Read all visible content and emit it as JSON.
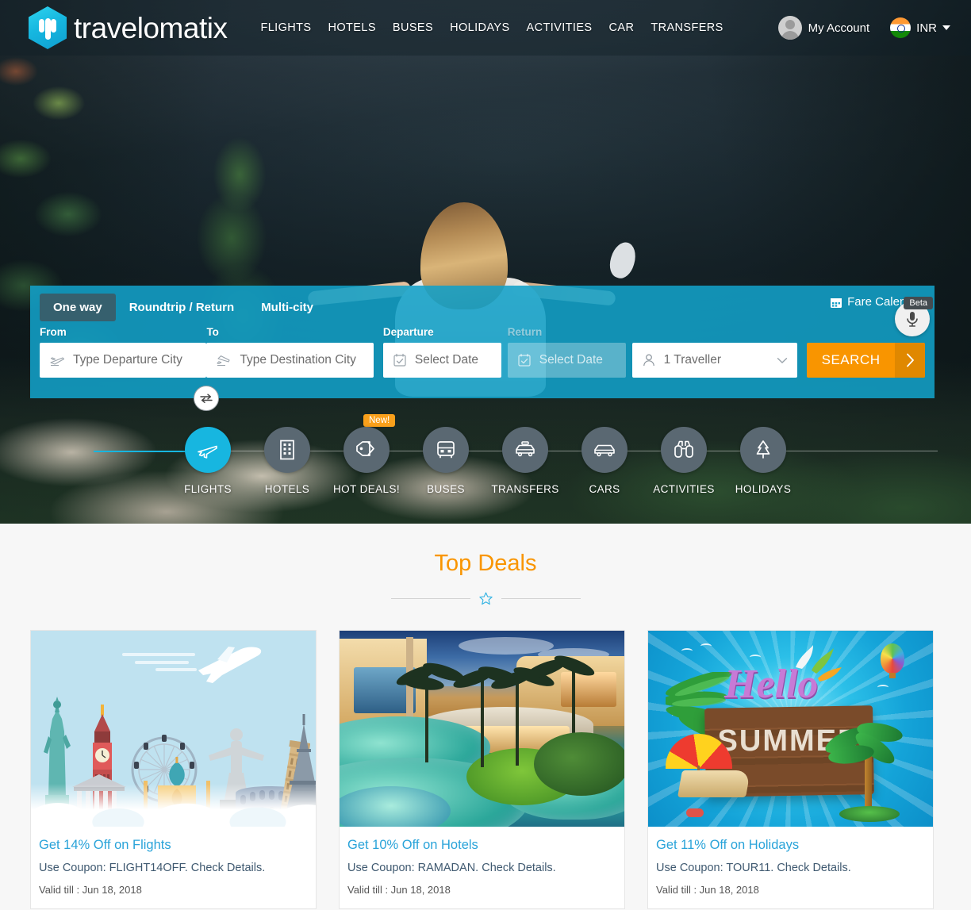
{
  "brand": {
    "name": "travelomatix",
    "logo_icon": "travelomatix-hex-logo"
  },
  "header": {
    "nav": [
      {
        "label": "FLIGHTS"
      },
      {
        "label": "HOTELS"
      },
      {
        "label": "BUSES"
      },
      {
        "label": "HOLIDAYS"
      },
      {
        "label": "ACTIVITIES"
      },
      {
        "label": "CAR"
      },
      {
        "label": "TRANSFERS"
      }
    ],
    "account": {
      "label": "My Account",
      "icon": "user-avatar-icon"
    },
    "currency": {
      "code": "INR",
      "flag": "india-flag-icon",
      "caret": "chevron-down-icon"
    }
  },
  "search_widget": {
    "trip_tabs": [
      {
        "label": "One way",
        "active": true
      },
      {
        "label": "Roundtrip / Return",
        "active": false
      },
      {
        "label": "Multi-city",
        "active": false
      }
    ],
    "fare_calendar": {
      "label": "Fare Calendar",
      "icon": "calendar-icon"
    },
    "voice": {
      "badge": "Beta",
      "icon": "microphone-icon"
    },
    "from": {
      "label": "From",
      "placeholder": "Type Departure City",
      "value": "",
      "icon": "plane-departure-icon"
    },
    "swap": {
      "icon": "swap-arrows-icon"
    },
    "to": {
      "label": "To",
      "placeholder": "Type Destination City",
      "value": "",
      "icon": "plane-arrival-icon"
    },
    "departure": {
      "label": "Departure",
      "placeholder": "Select Date",
      "value": "",
      "icon": "calendar-check-icon"
    },
    "return": {
      "label": "Return",
      "placeholder": "Select Date",
      "value": "",
      "icon": "calendar-check-icon",
      "disabled": true
    },
    "travellers": {
      "value": "1 Traveller",
      "icon": "person-icon",
      "caret": "chevron-down-icon"
    },
    "search_button": {
      "label": "SEARCH",
      "arrow": "chevron-right-icon",
      "color": "#f99500"
    }
  },
  "categories": [
    {
      "label": "FLIGHTS",
      "icon": "airplane-icon",
      "active": true
    },
    {
      "label": "HOTELS",
      "icon": "building-icon",
      "active": false
    },
    {
      "label": "HOT DEALS!",
      "icon": "tags-icon",
      "active": false,
      "badge": "New!"
    },
    {
      "label": "BUSES",
      "icon": "bus-icon",
      "active": false
    },
    {
      "label": "TRANSFERS",
      "icon": "taxi-icon",
      "active": false
    },
    {
      "label": "CARS",
      "icon": "car-icon",
      "active": false
    },
    {
      "label": "ACTIVITIES",
      "icon": "binoculars-icon",
      "active": false
    },
    {
      "label": "HOLIDAYS",
      "icon": "tree-icon",
      "active": false
    }
  ],
  "top_deals": {
    "title": "Top Deals",
    "divider_icon": "star-outline-icon",
    "cards": [
      {
        "title": "Get 14% Off on Flights",
        "subtitle": "Use Coupon: FLIGHT14OFF. Check Details.",
        "valid": "Valid till : Jun 18, 2018",
        "image": "world-landmarks-airplane-illustration"
      },
      {
        "title": "Get 10% Off on Hotels",
        "subtitle": "Use Coupon: RAMADAN. Check Details.",
        "valid": "Valid till : Jun 18, 2018",
        "image": "luxury-resort-pool-photo"
      },
      {
        "title": "Get 11% Off on Holidays",
        "subtitle": "Use Coupon: TOUR11. Check Details.",
        "valid": "Valid till : Jun 18, 2018",
        "image": "hello-summer-beach-banner"
      }
    ]
  },
  "colors": {
    "accent_blue": "#17b6e0",
    "widget_blue": "#12a0c8",
    "orange": "#f99500",
    "link_blue": "#29a3d9",
    "dark_slate": "#5a6872"
  }
}
